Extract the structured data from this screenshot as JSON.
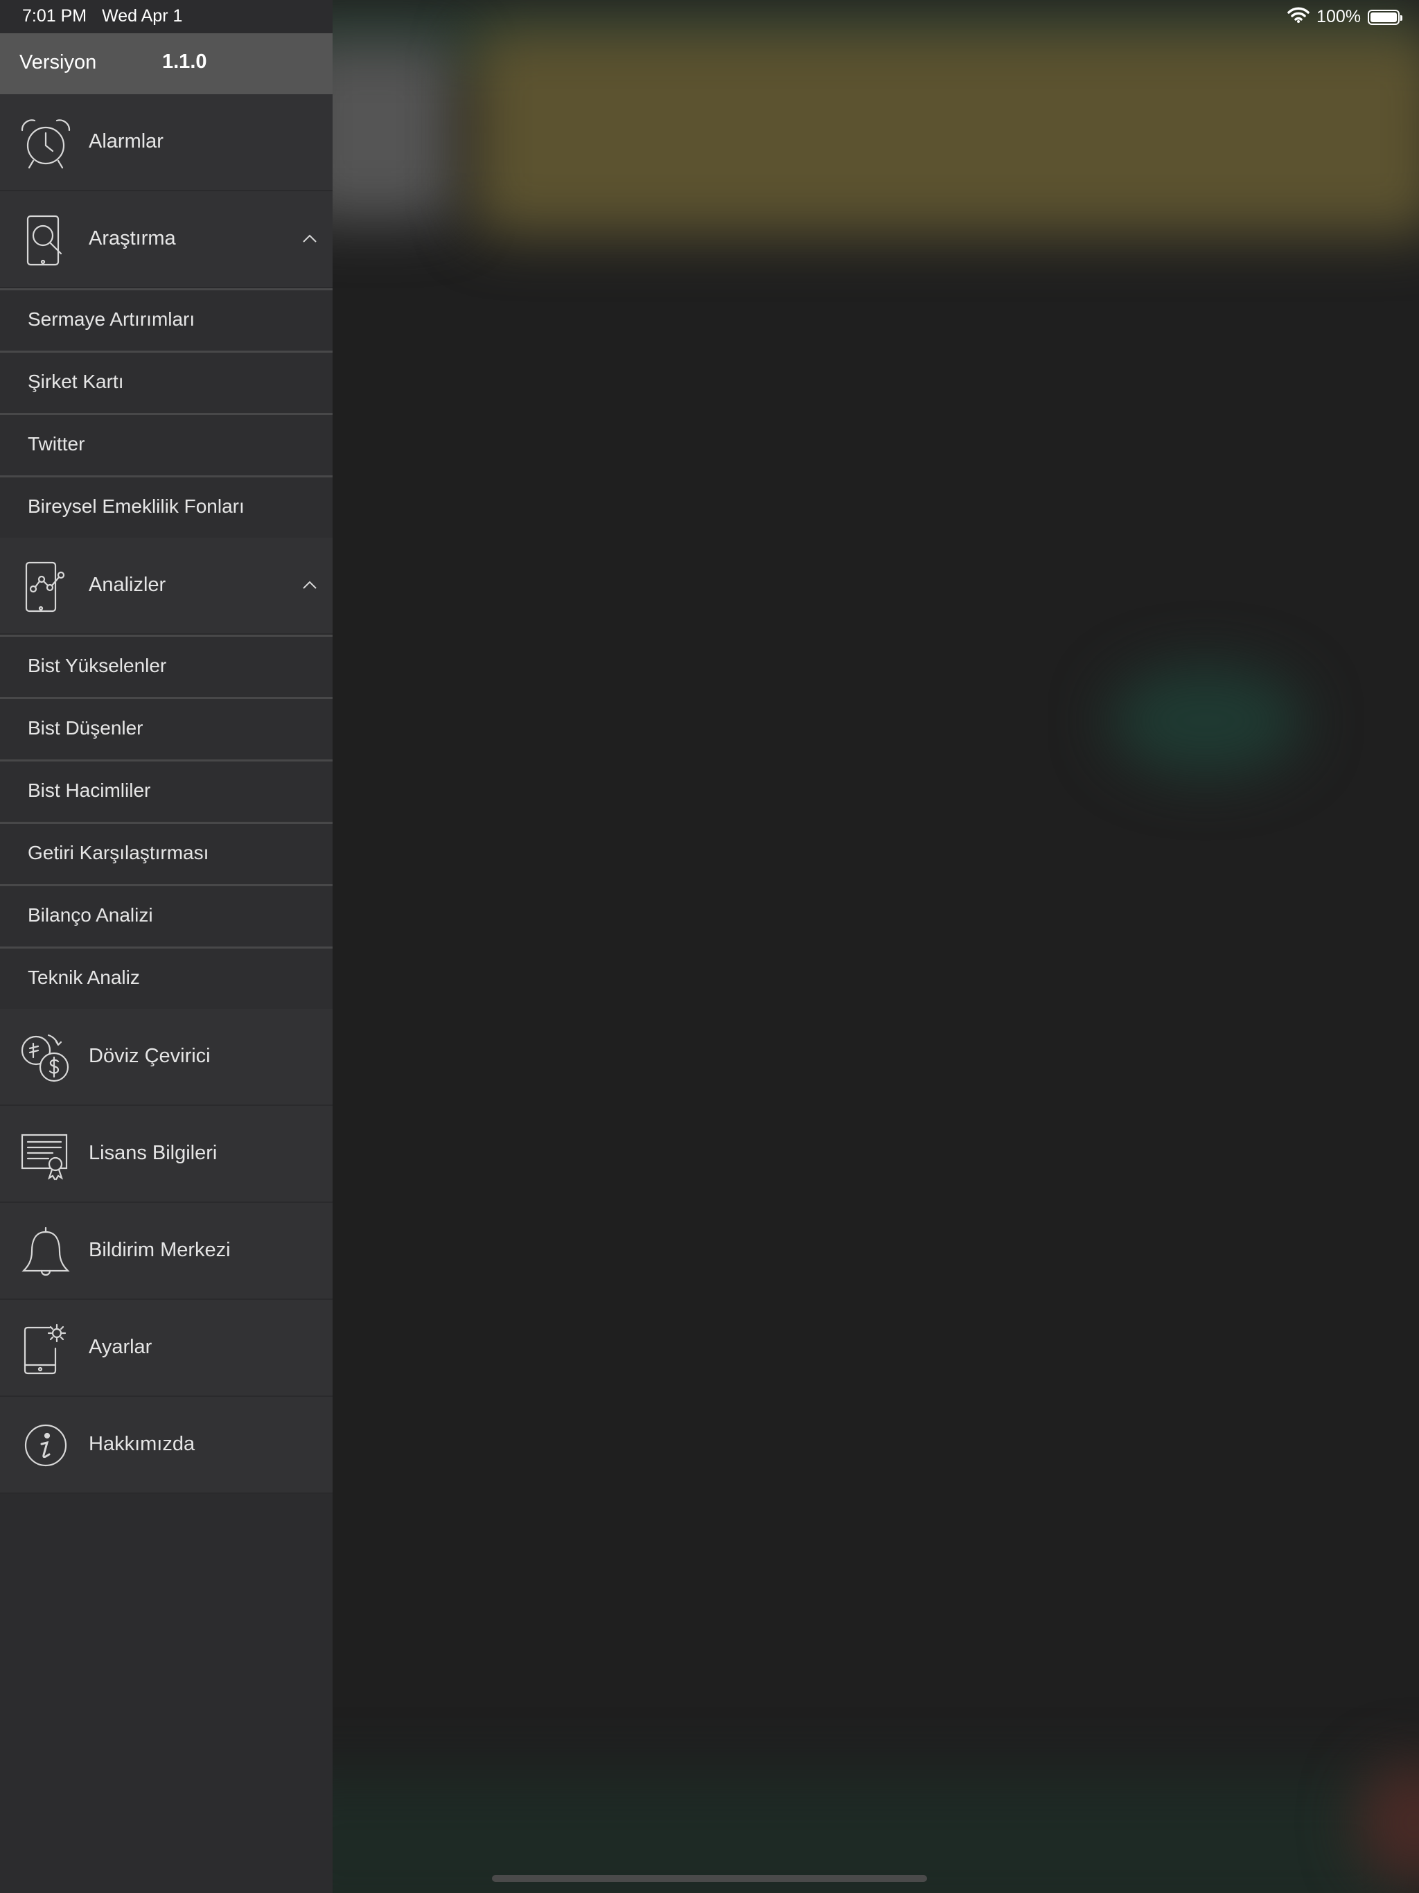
{
  "status_bar": {
    "time": "7:01 PM",
    "date": "Wed Apr 1",
    "battery_percent": "100%"
  },
  "version": {
    "label": "Versiyon",
    "value": "1.1.0"
  },
  "menu": {
    "alarms": "Alarmlar",
    "research": "Araştırma",
    "research_items": [
      "Sermaye Artırımları",
      "Şirket Kartı",
      "Twitter",
      "Bireysel Emeklilik Fonları"
    ],
    "analyses": "Analizler",
    "analyses_items": [
      "Bist Yükselenler",
      "Bist Düşenler",
      "Bist Hacimliler",
      "Getiri Karşılaştırması",
      "Bilanço Analizi",
      "Teknik Analiz"
    ],
    "currency_converter": "Döviz Çevirici",
    "license_info": "Lisans Bilgileri",
    "notification_center": "Bildirim Merkezi",
    "settings": "Ayarlar",
    "about": "Hakkımızda"
  },
  "icons": {
    "alarms": "alarm-clock-icon",
    "research": "phone-search-icon",
    "analyses": "phone-chart-icon",
    "currency_converter": "currency-exchange-icon",
    "license_info": "certificate-icon",
    "notification_center": "bell-icon",
    "settings": "phone-settings-icon",
    "about": "info-icon"
  },
  "colors": {
    "sidebar_bg": "#2c2c2e",
    "version_bar_bg": "#555555",
    "text": "#e6e6e6"
  }
}
